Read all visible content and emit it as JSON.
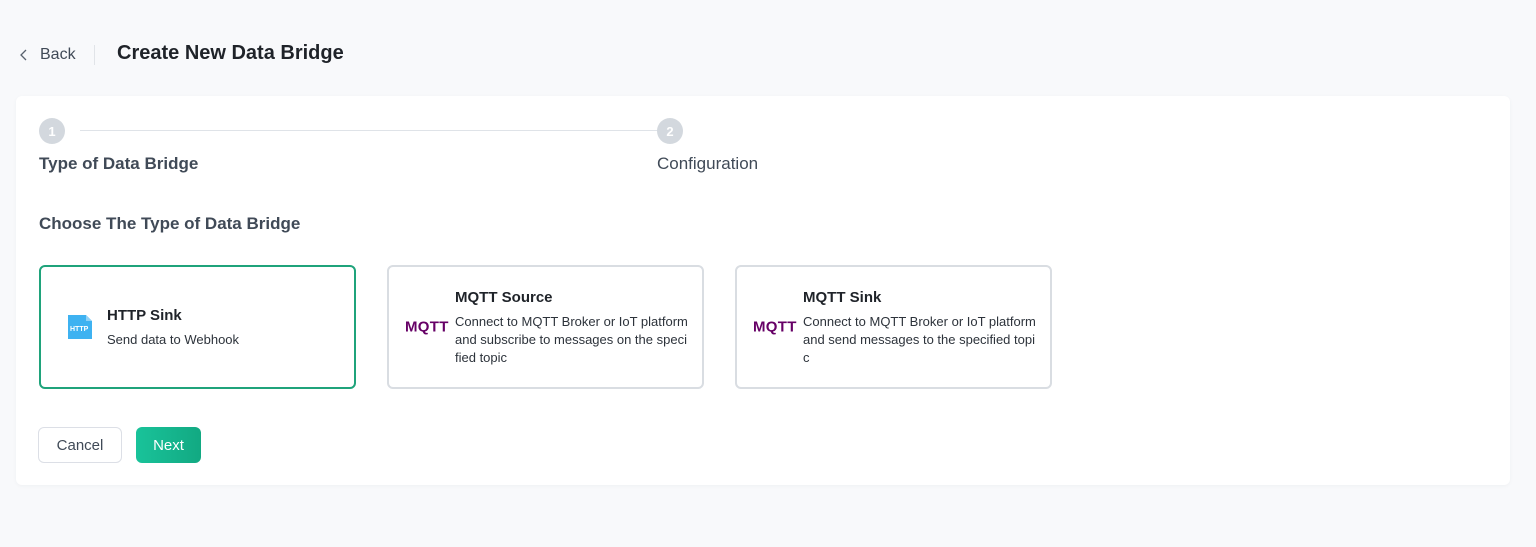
{
  "header": {
    "back_label": "Back",
    "title": "Create New Data Bridge"
  },
  "steps": [
    {
      "number": "1",
      "label": "Type of Data Bridge"
    },
    {
      "number": "2",
      "label": "Configuration"
    }
  ],
  "section_title": "Choose The Type of Data Bridge",
  "bridge_types": [
    {
      "name": "HTTP Sink",
      "description": "Send data to Webhook",
      "icon": "http-icon",
      "selected": true
    },
    {
      "name": "MQTT Source",
      "description": "Connect to MQTT Broker or IoT platform and subscribe to messages on the specified topic",
      "icon": "mqtt-icon",
      "icon_text": "MQTT"
    },
    {
      "name": "MQTT Sink",
      "description": "Connect to MQTT Broker or IoT platform and send messages to the specified topic",
      "icon": "mqtt-icon",
      "icon_text": "MQTT"
    }
  ],
  "buttons": {
    "cancel_label": "Cancel",
    "next_label": "Next"
  },
  "colors": {
    "accent": "#1fa37b",
    "mqtt_brand": "#660066",
    "http_icon": "#3eb2f1"
  }
}
